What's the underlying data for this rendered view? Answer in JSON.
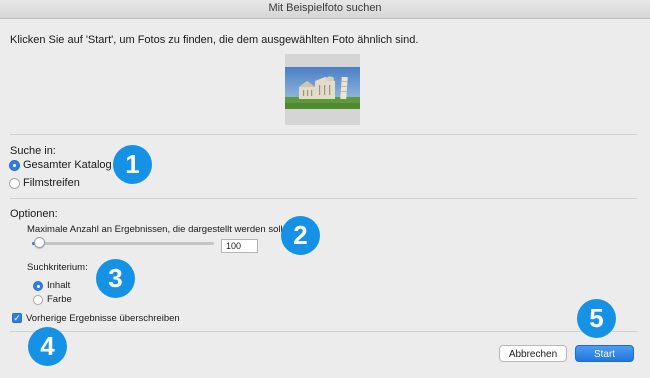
{
  "window": {
    "title": "Mit Beispielfoto suchen"
  },
  "intro_text": "Klicken Sie auf 'Start', um Fotos zu finden, die dem ausgewählten Foto ähnlich sind.",
  "search_in": {
    "heading": "Suche in:",
    "options": [
      {
        "label": "Gesamter Katalog",
        "selected": true
      },
      {
        "label": "Filmstreifen",
        "selected": false
      }
    ]
  },
  "options": {
    "heading": "Optionen:",
    "max_results_label": "Maximale Anzahl an Ergebnissen, die dargestellt werden sollen:",
    "max_results_value": "100",
    "slider_level": 0.01,
    "criterion_heading": "Suchkriterium:",
    "criteria": [
      {
        "label": "Inhalt",
        "selected": true
      },
      {
        "label": "Farbe",
        "selected": false
      }
    ],
    "overwrite_label": "Vorherige Ergebnisse überschreiben",
    "overwrite_checked": true
  },
  "badges": [
    "1",
    "2",
    "3",
    "4",
    "5"
  ],
  "buttons": {
    "cancel": "Abbrechen",
    "start": "Start"
  },
  "colors": {
    "accent": "#2f7fe0",
    "badge": "#1592e6"
  }
}
